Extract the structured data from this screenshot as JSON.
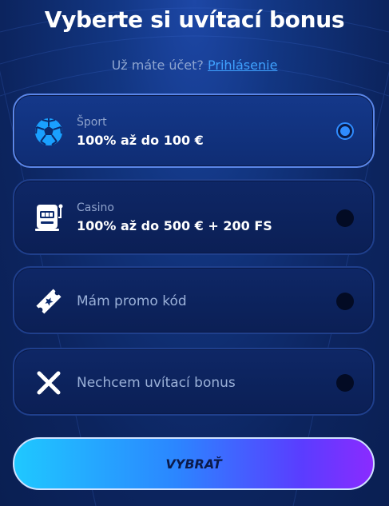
{
  "header": {
    "title": "Vyberte si uvítací bonus",
    "login_prompt": "Už máte účet?",
    "login_link": "Prihlásenie"
  },
  "options": [
    {
      "icon": "soccer-ball-icon",
      "caption": "Šport",
      "value": "100% až do 100 €",
      "selected": true
    },
    {
      "icon": "slot-machine-icon",
      "caption": "Casino",
      "value": "100% až do 500 € + 200 FS",
      "selected": false
    },
    {
      "icon": "ticket-icon",
      "label": "Mám promo kód",
      "selected": false
    },
    {
      "icon": "close-icon",
      "label": "Nechcem uvítací bonus",
      "selected": false
    }
  ],
  "cta": {
    "label": "VYBRAŤ"
  },
  "colors": {
    "accent": "#2f8cff",
    "link": "#3fa2ff",
    "background": "#0c245e"
  }
}
